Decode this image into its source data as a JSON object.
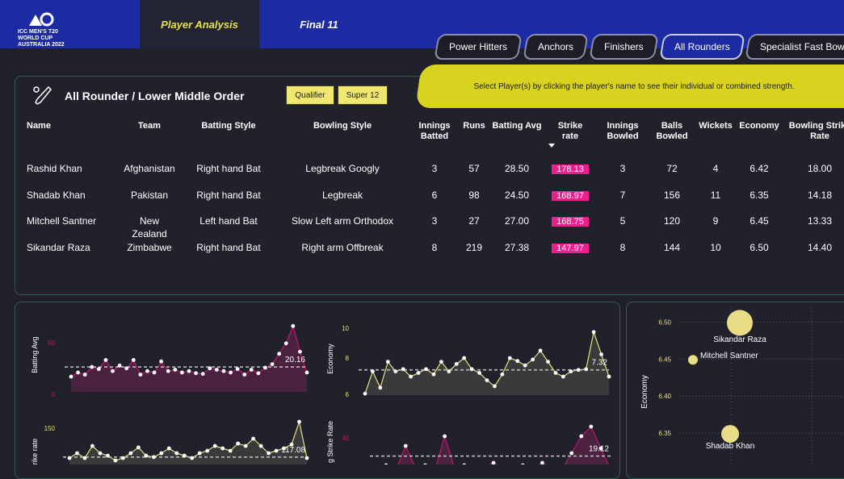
{
  "header": {
    "logo_text": "ICC MEN'S T20 WORLD CUP AUSTRALIA 2022",
    "tabs": [
      {
        "label": "Player Analysis"
      },
      {
        "label": "Final 11"
      }
    ]
  },
  "filters": [
    "Power Hitters",
    "Anchors",
    "Finishers",
    "All Rounders",
    "Specialist Fast Bow"
  ],
  "banner": "Select Player(s) by clicking the player's name to see their individual or combined strength.",
  "section": {
    "title": "All Rounder / Lower Middle Order",
    "chips": [
      "Qualifier",
      "Super 12"
    ]
  },
  "table": {
    "columns": [
      "Name",
      "Team",
      "Batting Style",
      "Bowling Style",
      "Innings Batted",
      "Runs",
      "Batting Avg",
      "Strike rate",
      "Innings Bowled",
      "Balls Bowled",
      "Wickets",
      "Economy",
      "Bowling Strike Rate"
    ],
    "rows": [
      [
        "Rashid Khan",
        "Afghanistan",
        "Right hand Bat",
        "Legbreak Googly",
        "3",
        "57",
        "28.50",
        "178.13",
        "3",
        "72",
        "4",
        "6.42",
        "18.00"
      ],
      [
        "Shadab Khan",
        "Pakistan",
        "Right hand Bat",
        "Legbreak",
        "6",
        "98",
        "24.50",
        "168.97",
        "7",
        "156",
        "11",
        "6.35",
        "14.18"
      ],
      [
        "Mitchell Santner",
        "New Zealand",
        "Left hand Bat",
        "Slow Left arm Orthodox",
        "3",
        "27",
        "27.00",
        "168.75",
        "5",
        "120",
        "9",
        "6.45",
        "13.33"
      ],
      [
        "Sikandar Raza",
        "Zimbabwe",
        "Right hand Bat",
        "Right arm Offbreak",
        "8",
        "219",
        "27.38",
        "147.97",
        "8",
        "144",
        "10",
        "6.50",
        "14.40"
      ]
    ]
  },
  "mini_charts": [
    {
      "ylabel": "Batting Avg",
      "ymax_label": "50",
      "ymin_label": "0",
      "ref_label": "20.16",
      "color": "#c0166e"
    },
    {
      "ylabel": "Economy",
      "ymax_label": "10",
      "ymid_label": "8",
      "ymin_label": "6",
      "ref_label": "7.32",
      "color": "#e8e07a"
    },
    {
      "ylabel": "rike rate",
      "ymax_label": "150",
      "ref_label": "117.08",
      "color": "#e8e07a"
    },
    {
      "ylabel": "g Strike Rate",
      "ymax_label": "40",
      "ref_label": "19.12",
      "color": "#c0166e"
    }
  ],
  "chart_data": {
    "type": "scatter",
    "title": "",
    "ylabel": "Economy",
    "yticks": [
      "6.50",
      "6.45",
      "6.40",
      "6.35"
    ],
    "points": [
      {
        "label": "Sikandar Raza",
        "y": 6.5
      },
      {
        "label": "Mitchell Santner",
        "y": 6.45
      },
      {
        "label": "Shadab Khan",
        "y": 6.35
      }
    ]
  }
}
